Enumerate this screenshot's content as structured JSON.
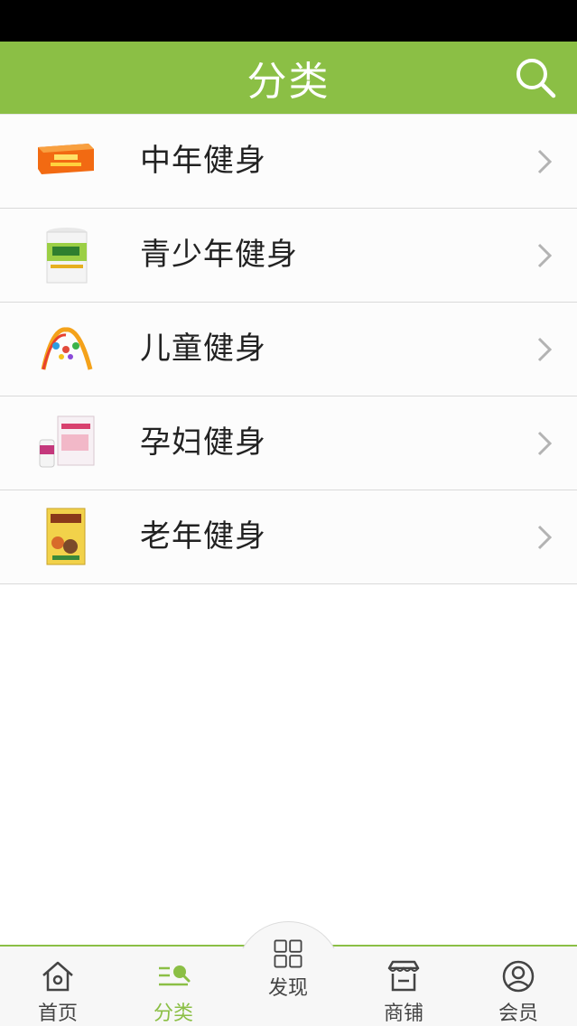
{
  "header": {
    "title": "分类",
    "accent_color": "#8bbf45",
    "search_icon": "search-icon"
  },
  "categories": [
    {
      "label": "中年健身",
      "thumb": "orange-gift-box"
    },
    {
      "label": "青少年健身",
      "thumb": "milk-powder-can"
    },
    {
      "label": "儿童健身",
      "thumb": "baby-play-gym"
    },
    {
      "label": "孕妇健身",
      "thumb": "maternal-supplement-box"
    },
    {
      "label": "老年健身",
      "thumb": "cereal-box"
    }
  ],
  "tabbar": {
    "items": [
      {
        "label": "首页",
        "icon": "home-icon",
        "active": false
      },
      {
        "label": "分类",
        "icon": "category-search-icon",
        "active": true
      },
      {
        "label": "发现",
        "icon": "grid-icon",
        "active": false
      },
      {
        "label": "商铺",
        "icon": "store-icon",
        "active": false
      },
      {
        "label": "会员",
        "icon": "user-icon",
        "active": false
      }
    ]
  }
}
